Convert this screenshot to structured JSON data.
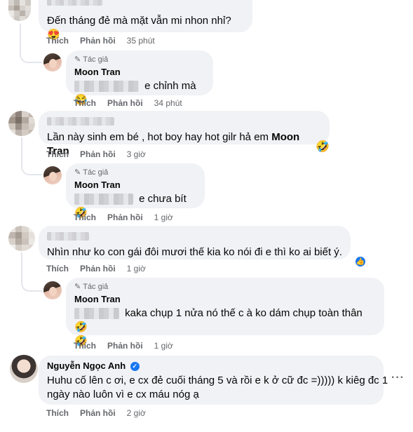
{
  "labels": {
    "like": "Thích",
    "reply": "Phản hồi",
    "author": "Tác giả"
  },
  "comments": [
    {
      "name": "",
      "text": "Đến tháng đẻ mà mặt vẫn mi nhon nhỉ?",
      "emoji": "😍",
      "time": "35 phút"
    },
    {
      "name": "Moon Tran",
      "text": "e chỉnh mà",
      "emoji": "😂",
      "time": "34 phút"
    },
    {
      "name": "",
      "text": "Lần này sinh em bé , hot boy hay hot gilr hả em",
      "mention": "Moon Tran",
      "emoji": "🤣",
      "time": "3 giờ"
    },
    {
      "name": "Moon Tran",
      "text": "e chưa bít",
      "emoji": "🤣",
      "time": "1 giờ"
    },
    {
      "name": "",
      "text": "Nhìn như ko con gái đôi mươi thế kia ko nói đi e thì ko ai biết ý.",
      "reaction": "👍",
      "time": "1 giờ"
    },
    {
      "name": "Moon Tran",
      "text": "kaka chụp 1 nửa nó thế c à ko dám chụp toàn thân",
      "emoji": "🤣",
      "emoji2": "🤣",
      "time": "1 giờ"
    },
    {
      "name": "Nguyễn Ngọc Anh",
      "verified": "✓",
      "text_line1": "Huhu cố lên c ơi, e cx đẻ cuối tháng 5 và rồi e k ở cữ đc =))))) k kiêg đc 1",
      "text_line2": "ngày nào luôn vì e cx máu nóg ạ",
      "more": "···",
      "time": "2 giờ"
    }
  ],
  "colors": {
    "bubble": "#f0f2f5",
    "meta": "#65676b",
    "accent": "#1877f2"
  }
}
